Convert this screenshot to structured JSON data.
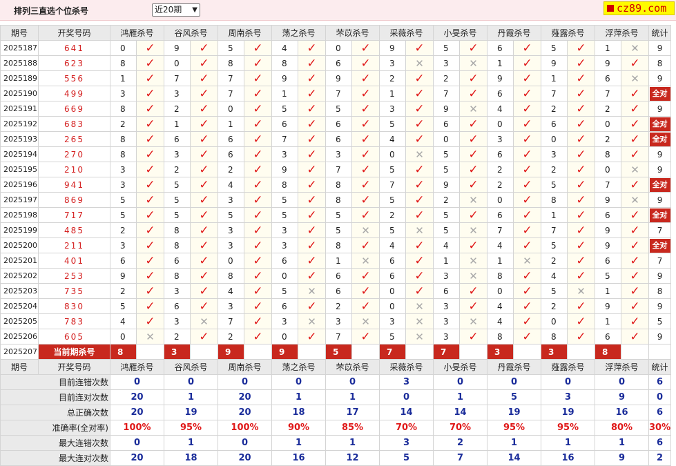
{
  "header": {
    "title": "排列三直选个位杀号",
    "range_select": "近20期",
    "brand": "cz89.com"
  },
  "columns": [
    "期号",
    "开奖号码",
    "鸿雁杀号",
    "谷风杀号",
    "周南杀号",
    "荡之杀号",
    "芣苡杀号",
    "采薇杀号",
    "小旻杀号",
    "丹霞杀号",
    "薤露杀号",
    "浮萍杀号",
    "统计"
  ],
  "marks": {
    "ok": "✓",
    "no": "✕"
  },
  "rows": [
    {
      "issue": "2025187",
      "num": "641",
      "k": [
        [
          "0",
          1
        ],
        [
          "9",
          1
        ],
        [
          "5",
          1
        ],
        [
          "4",
          1
        ],
        [
          "0",
          1
        ],
        [
          "9",
          1
        ],
        [
          "5",
          1
        ],
        [
          "6",
          1
        ],
        [
          "5",
          1
        ],
        [
          "1",
          0
        ]
      ],
      "total": "9"
    },
    {
      "issue": "2025188",
      "num": "623",
      "k": [
        [
          "8",
          1
        ],
        [
          "0",
          1
        ],
        [
          "8",
          1
        ],
        [
          "8",
          1
        ],
        [
          "6",
          1
        ],
        [
          "3",
          0
        ],
        [
          "3",
          0
        ],
        [
          "1",
          1
        ],
        [
          "9",
          1
        ],
        [
          "9",
          1
        ]
      ],
      "total": "8"
    },
    {
      "issue": "2025189",
      "num": "556",
      "k": [
        [
          "1",
          1
        ],
        [
          "7",
          1
        ],
        [
          "7",
          1
        ],
        [
          "9",
          1
        ],
        [
          "9",
          1
        ],
        [
          "2",
          1
        ],
        [
          "2",
          1
        ],
        [
          "9",
          1
        ],
        [
          "1",
          1
        ],
        [
          "6",
          0
        ]
      ],
      "total": "9"
    },
    {
      "issue": "2025190",
      "num": "499",
      "k": [
        [
          "3",
          1
        ],
        [
          "3",
          1
        ],
        [
          "7",
          1
        ],
        [
          "1",
          1
        ],
        [
          "7",
          1
        ],
        [
          "1",
          1
        ],
        [
          "7",
          1
        ],
        [
          "6",
          1
        ],
        [
          "7",
          1
        ],
        [
          "7",
          1
        ]
      ],
      "total": "全对"
    },
    {
      "issue": "2025191",
      "num": "669",
      "k": [
        [
          "8",
          1
        ],
        [
          "2",
          1
        ],
        [
          "0",
          1
        ],
        [
          "5",
          1
        ],
        [
          "5",
          1
        ],
        [
          "3",
          1
        ],
        [
          "9",
          0
        ],
        [
          "4",
          1
        ],
        [
          "2",
          1
        ],
        [
          "2",
          1
        ]
      ],
      "total": "9"
    },
    {
      "issue": "2025192",
      "num": "683",
      "k": [
        [
          "2",
          1
        ],
        [
          "1",
          1
        ],
        [
          "1",
          1
        ],
        [
          "6",
          1
        ],
        [
          "6",
          1
        ],
        [
          "5",
          1
        ],
        [
          "6",
          1
        ],
        [
          "0",
          1
        ],
        [
          "6",
          1
        ],
        [
          "0",
          1
        ]
      ],
      "total": "全对"
    },
    {
      "issue": "2025193",
      "num": "265",
      "k": [
        [
          "8",
          1
        ],
        [
          "6",
          1
        ],
        [
          "6",
          1
        ],
        [
          "7",
          1
        ],
        [
          "6",
          1
        ],
        [
          "4",
          1
        ],
        [
          "0",
          1
        ],
        [
          "3",
          1
        ],
        [
          "0",
          1
        ],
        [
          "2",
          1
        ]
      ],
      "total": "全对"
    },
    {
      "issue": "2025194",
      "num": "270",
      "k": [
        [
          "8",
          1
        ],
        [
          "3",
          1
        ],
        [
          "6",
          1
        ],
        [
          "3",
          1
        ],
        [
          "3",
          1
        ],
        [
          "0",
          0
        ],
        [
          "5",
          1
        ],
        [
          "6",
          1
        ],
        [
          "3",
          1
        ],
        [
          "8",
          1
        ]
      ],
      "total": "9"
    },
    {
      "issue": "2025195",
      "num": "210",
      "k": [
        [
          "3",
          1
        ],
        [
          "2",
          1
        ],
        [
          "2",
          1
        ],
        [
          "9",
          1
        ],
        [
          "7",
          1
        ],
        [
          "5",
          1
        ],
        [
          "5",
          1
        ],
        [
          "2",
          1
        ],
        [
          "2",
          1
        ],
        [
          "0",
          0
        ]
      ],
      "total": "9"
    },
    {
      "issue": "2025196",
      "num": "941",
      "k": [
        [
          "3",
          1
        ],
        [
          "5",
          1
        ],
        [
          "4",
          1
        ],
        [
          "8",
          1
        ],
        [
          "8",
          1
        ],
        [
          "7",
          1
        ],
        [
          "9",
          1
        ],
        [
          "2",
          1
        ],
        [
          "5",
          1
        ],
        [
          "7",
          1
        ]
      ],
      "total": "全对"
    },
    {
      "issue": "2025197",
      "num": "869",
      "k": [
        [
          "5",
          1
        ],
        [
          "5",
          1
        ],
        [
          "3",
          1
        ],
        [
          "5",
          1
        ],
        [
          "8",
          1
        ],
        [
          "5",
          1
        ],
        [
          "2",
          0
        ],
        [
          "0",
          1
        ],
        [
          "8",
          1
        ],
        [
          "9",
          0
        ]
      ],
      "total": "9"
    },
    {
      "issue": "2025198",
      "num": "717",
      "k": [
        [
          "5",
          1
        ],
        [
          "5",
          1
        ],
        [
          "5",
          1
        ],
        [
          "5",
          1
        ],
        [
          "5",
          1
        ],
        [
          "2",
          1
        ],
        [
          "5",
          1
        ],
        [
          "6",
          1
        ],
        [
          "1",
          1
        ],
        [
          "6",
          1
        ]
      ],
      "total": "全对"
    },
    {
      "issue": "2025199",
      "num": "485",
      "k": [
        [
          "2",
          1
        ],
        [
          "8",
          1
        ],
        [
          "3",
          1
        ],
        [
          "3",
          1
        ],
        [
          "5",
          0
        ],
        [
          "5",
          0
        ],
        [
          "5",
          0
        ],
        [
          "7",
          1
        ],
        [
          "7",
          1
        ],
        [
          "9",
          1
        ]
      ],
      "total": "7"
    },
    {
      "issue": "2025200",
      "num": "211",
      "k": [
        [
          "3",
          1
        ],
        [
          "8",
          1
        ],
        [
          "3",
          1
        ],
        [
          "3",
          1
        ],
        [
          "8",
          1
        ],
        [
          "4",
          1
        ],
        [
          "4",
          1
        ],
        [
          "4",
          1
        ],
        [
          "5",
          1
        ],
        [
          "9",
          1
        ]
      ],
      "total": "全对"
    },
    {
      "issue": "2025201",
      "num": "401",
      "k": [
        [
          "6",
          1
        ],
        [
          "6",
          1
        ],
        [
          "0",
          1
        ],
        [
          "6",
          1
        ],
        [
          "1",
          0
        ],
        [
          "6",
          1
        ],
        [
          "1",
          0
        ],
        [
          "1",
          0
        ],
        [
          "2",
          1
        ],
        [
          "6",
          1
        ]
      ],
      "total": "7"
    },
    {
      "issue": "2025202",
      "num": "253",
      "k": [
        [
          "9",
          1
        ],
        [
          "8",
          1
        ],
        [
          "8",
          1
        ],
        [
          "0",
          1
        ],
        [
          "6",
          1
        ],
        [
          "6",
          1
        ],
        [
          "3",
          0
        ],
        [
          "8",
          1
        ],
        [
          "4",
          1
        ],
        [
          "5",
          1
        ]
      ],
      "total": "9"
    },
    {
      "issue": "2025203",
      "num": "735",
      "k": [
        [
          "2",
          1
        ],
        [
          "3",
          1
        ],
        [
          "4",
          1
        ],
        [
          "5",
          0
        ],
        [
          "6",
          1
        ],
        [
          "0",
          1
        ],
        [
          "6",
          1
        ],
        [
          "0",
          1
        ],
        [
          "5",
          0
        ],
        [
          "1",
          1
        ]
      ],
      "total": "8"
    },
    {
      "issue": "2025204",
      "num": "830",
      "k": [
        [
          "5",
          1
        ],
        [
          "6",
          1
        ],
        [
          "3",
          1
        ],
        [
          "6",
          1
        ],
        [
          "2",
          1
        ],
        [
          "0",
          0
        ],
        [
          "3",
          1
        ],
        [
          "4",
          1
        ],
        [
          "2",
          1
        ],
        [
          "9",
          1
        ]
      ],
      "total": "9"
    },
    {
      "issue": "2025205",
      "num": "783",
      "k": [
        [
          "4",
          1
        ],
        [
          "3",
          0
        ],
        [
          "7",
          1
        ],
        [
          "3",
          0
        ],
        [
          "3",
          0
        ],
        [
          "3",
          0
        ],
        [
          "3",
          0
        ],
        [
          "4",
          1
        ],
        [
          "0",
          1
        ],
        [
          "1",
          1
        ]
      ],
      "total": "5"
    },
    {
      "issue": "2025206",
      "num": "605",
      "k": [
        [
          "0",
          0
        ],
        [
          "2",
          1
        ],
        [
          "2",
          1
        ],
        [
          "0",
          1
        ],
        [
          "7",
          1
        ],
        [
          "5",
          0
        ],
        [
          "3",
          1
        ],
        [
          "8",
          1
        ],
        [
          "8",
          1
        ],
        [
          "6",
          1
        ]
      ],
      "total": "9"
    }
  ],
  "current": {
    "issue": "2025207",
    "label": "当前期杀号",
    "kills": [
      "8",
      "3",
      "9",
      "9",
      "5",
      "7",
      "7",
      "3",
      "3",
      "8"
    ]
  },
  "stats": [
    {
      "label": "目前连错次数",
      "color": "b",
      "values": [
        "0",
        "0",
        "0",
        "0",
        "0",
        "3",
        "0",
        "0",
        "0",
        "0",
        "6"
      ]
    },
    {
      "label": "目前连对次数",
      "color": "b",
      "values": [
        "20",
        "1",
        "20",
        "1",
        "1",
        "0",
        "1",
        "5",
        "3",
        "9",
        "0"
      ]
    },
    {
      "label": "总正确次数",
      "color": "b",
      "values": [
        "20",
        "19",
        "20",
        "18",
        "17",
        "14",
        "14",
        "19",
        "19",
        "16",
        "6"
      ]
    },
    {
      "label": "准确率(全对率)",
      "color": "r",
      "values": [
        "100%",
        "95%",
        "100%",
        "90%",
        "85%",
        "70%",
        "70%",
        "95%",
        "95%",
        "80%",
        "30%"
      ]
    },
    {
      "label": "最大连错次数",
      "color": "b",
      "values": [
        "0",
        "1",
        "0",
        "1",
        "1",
        "3",
        "2",
        "1",
        "1",
        "1",
        "6"
      ]
    },
    {
      "label": "最大连对次数",
      "color": "b",
      "values": [
        "20",
        "18",
        "20",
        "16",
        "12",
        "5",
        "7",
        "14",
        "16",
        "9",
        "2"
      ]
    }
  ],
  "colors": {
    "accent_red": "#c8281e",
    "check_red": "#e01818",
    "stat_blue": "#1a2c9a"
  }
}
